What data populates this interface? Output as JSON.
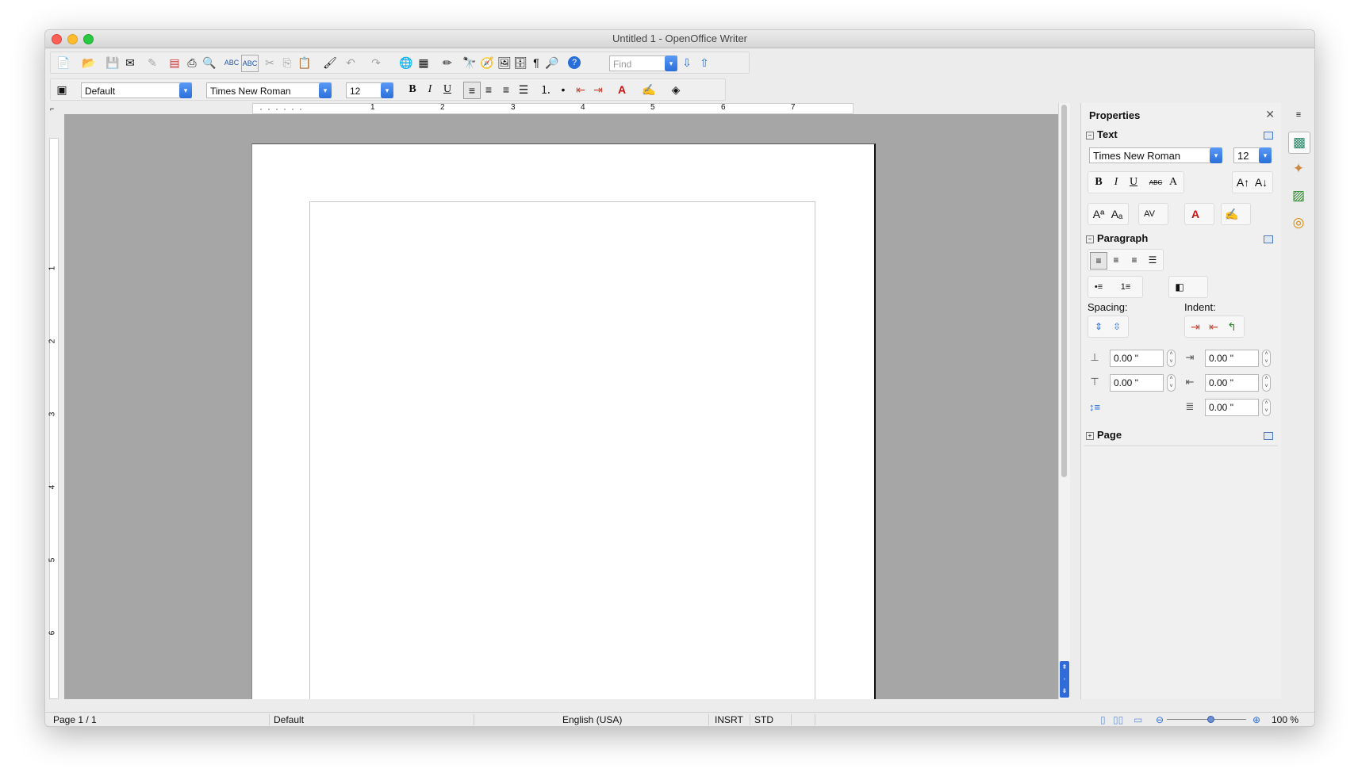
{
  "window": {
    "title": "Untitled 1 - OpenOffice Writer"
  },
  "toolbar1": {
    "find_placeholder": "Find"
  },
  "toolbar2": {
    "paragraph_style": "Default",
    "font_name": "Times New Roman",
    "font_size": "12"
  },
  "ruler": {
    "h_labels": [
      "1",
      "2",
      "3",
      "4",
      "5",
      "6",
      "7"
    ],
    "v_labels": [
      "1",
      "2",
      "3",
      "4",
      "5",
      "6"
    ]
  },
  "sidebar": {
    "title": "Properties",
    "text_section": {
      "label": "Text",
      "font_name": "Times New Roman",
      "font_size": "12"
    },
    "paragraph_section": {
      "label": "Paragraph",
      "spacing_label": "Spacing:",
      "indent_label": "Indent:",
      "above_spacing": "0.00 \"",
      "below_spacing": "0.00 \"",
      "before_indent": "0.00 \"",
      "after_indent": "0.00 \"",
      "first_line_indent": "0.00 \""
    },
    "page_section": {
      "label": "Page"
    }
  },
  "statusbar": {
    "page": "Page 1 / 1",
    "page_style": "Default",
    "language": "English (USA)",
    "insert_mode": "INSRT",
    "selection_mode": "STD",
    "zoom": "100 %"
  }
}
